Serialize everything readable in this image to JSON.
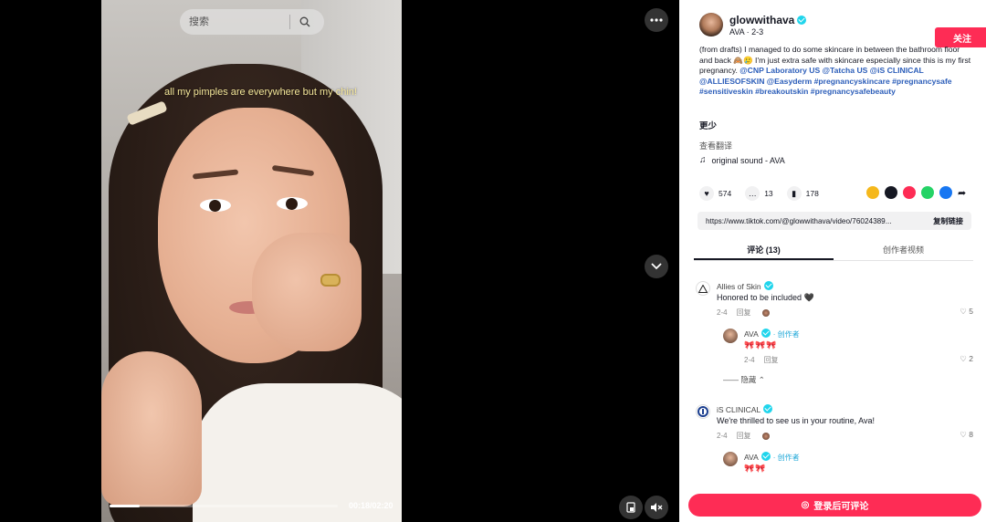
{
  "search": {
    "placeholder": "搜索"
  },
  "video": {
    "caption": "all my pimples are everywhere but my chin!",
    "time": "00:18/02:20",
    "progress_fraction": 0.13
  },
  "author": {
    "name": "glowwithava",
    "meta": "AVA · 2-3",
    "follow_label": "关注"
  },
  "description": {
    "text": "(from drafts) I managed to do some skincare in between the bathroom floor and back 🙈🥲 I'm just extra safe with skincare especially since this is my first pregnancy.",
    "tags": "@CNP Laboratory US @Tatcha US @iS CLINICAL @ALLIESOFSKIN @Easyderm #pregnancyskincare #pregnancysafe #sensitiveskin #breakoutskin #pregnancysafebeauty",
    "more": "更少",
    "translate": "查看翻译"
  },
  "sound": {
    "label": "original sound - AVA"
  },
  "stats": {
    "likes": "574",
    "comments": "13",
    "saves": "178"
  },
  "link": {
    "url": "https://www.tiktok.com/@glowwithava/video/76024389...",
    "copy_label": "复制链接"
  },
  "tabs": {
    "comments": "评论 (13)",
    "creator_videos": "创作者视频"
  },
  "comments": [
    {
      "name": "Allies of Skin",
      "text": "Honored to be included 🖤",
      "date": "2-4",
      "reply": "回复",
      "likes": "5"
    },
    {
      "name": "AVA",
      "creator": "· 创作者",
      "text": "🎀🎀🎀",
      "date": "2-4",
      "reply": "回复",
      "likes": "2"
    },
    {
      "name": "iS CLINICAL",
      "text": "We're thrilled to see us in your routine, Ava!",
      "date": "2-4",
      "reply": "回复",
      "likes": "8"
    },
    {
      "name": "AVA",
      "creator": "· 创作者",
      "text": "🎀🎀"
    }
  ],
  "hide_label": "隐藏",
  "comment_bar": {
    "label": "登录后可评论"
  },
  "colors": {
    "accent": "#fe2c55",
    "verified": "#20d5ec",
    "tag": "#2b5db9"
  }
}
